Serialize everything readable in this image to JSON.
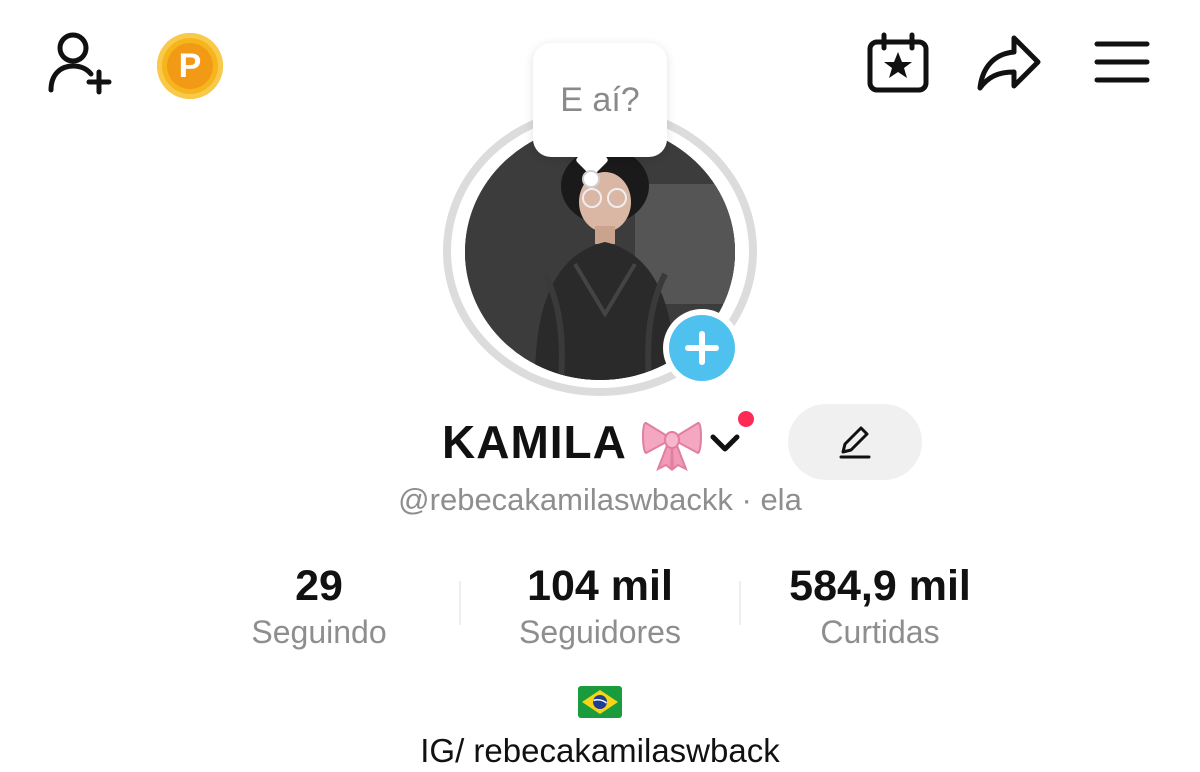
{
  "header": {
    "coin_letter": "P",
    "icons": [
      "add-friend-icon",
      "coin-icon",
      "calendar-star-icon",
      "share-icon",
      "menu-icon"
    ]
  },
  "profile": {
    "bubble_text": "E aí?",
    "display_name": "KAMILA",
    "handle": "@rebecakamilaswbackk",
    "pronoun_separator": " · ",
    "pronoun": "ela",
    "bio_flag": "brazil-flag-emoji",
    "bio_text": "IG/ rebecakamilaswback"
  },
  "stats": [
    {
      "value": "29",
      "label": "Seguindo"
    },
    {
      "value": "104 mil",
      "label": "Seguidores"
    },
    {
      "value": "584,9 mil",
      "label": "Curtidas"
    }
  ],
  "colors": {
    "accent_blue": "#4fc1ef",
    "notification_red": "#fe2c55",
    "coin_orange": "#f29a16",
    "secondary_text": "#8e8e8e"
  }
}
